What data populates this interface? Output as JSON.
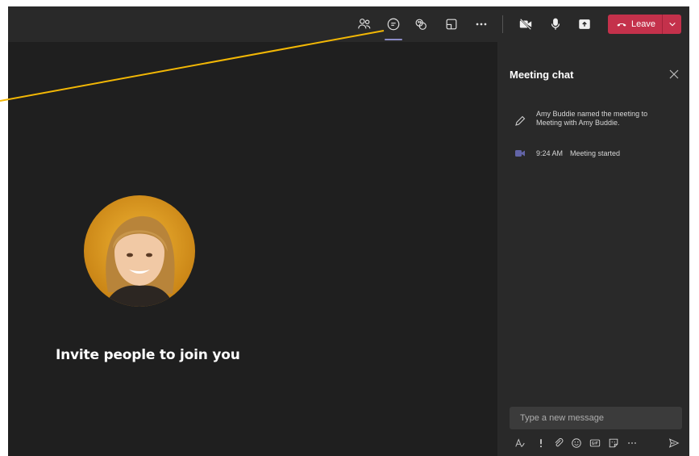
{
  "toolbar": {
    "leave_label": "Leave"
  },
  "stage": {
    "invite_text": "Invite people to join you"
  },
  "chat": {
    "title": "Meeting chat",
    "events": [
      {
        "icon": "pencil-icon",
        "text": "Amy Buddie named the meeting to Meeting with Amy Buddie."
      },
      {
        "icon": "meeting-camera-icon",
        "time": "9:24 AM",
        "text": "Meeting started"
      }
    ],
    "compose_placeholder": "Type a new message"
  },
  "colors": {
    "leave_button": "#c4314b",
    "callout_line": "#f2b705",
    "active_underline": "#8b8cc7",
    "meeting_icon": "#6264a7"
  }
}
